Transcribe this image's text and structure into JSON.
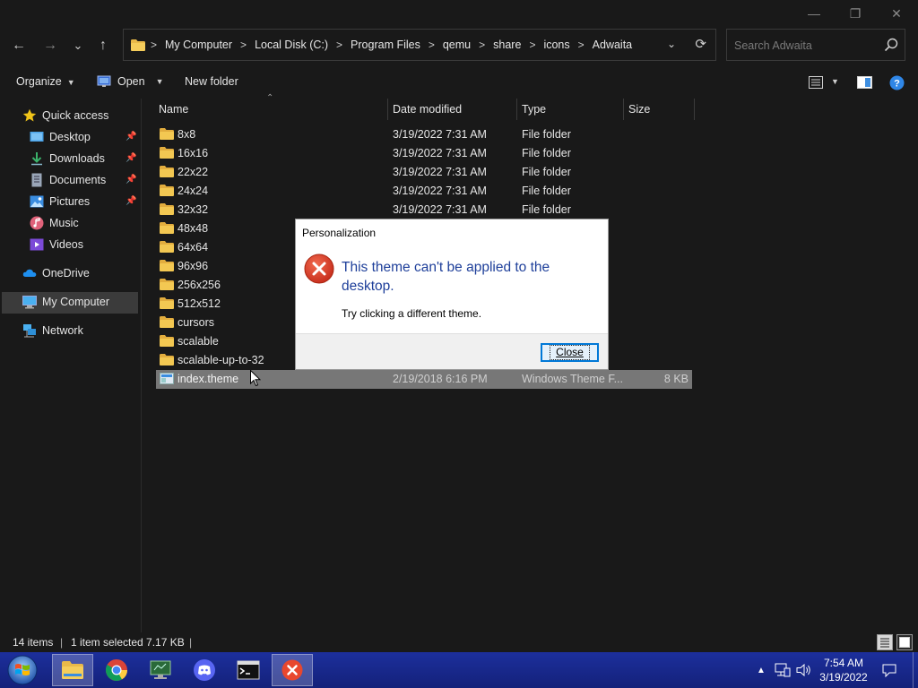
{
  "window": {
    "minimize_glyph": "—",
    "maximize_glyph": "❐",
    "close_glyph": "✕"
  },
  "nav_buttons": {
    "back": "←",
    "forward": "→",
    "recent": "⌄",
    "up": "↑"
  },
  "address": {
    "crumbs": [
      "My Computer",
      "Local Disk (C:)",
      "Program Files",
      "qemu",
      "share",
      "icons",
      "Adwaita"
    ],
    "separator": ">",
    "dropdown_glyph": "⌄",
    "refresh_glyph": "⟳"
  },
  "search": {
    "placeholder": "Search Adwaita"
  },
  "commands": {
    "organize": "Organize",
    "open": "Open",
    "new_folder": "New folder"
  },
  "nav_pane": {
    "items": [
      {
        "label": "Quick access",
        "icon": "star-icon",
        "pinned": false
      },
      {
        "label": "Desktop",
        "icon": "desktop-icon",
        "pinned": true
      },
      {
        "label": "Downloads",
        "icon": "download-icon",
        "pinned": true
      },
      {
        "label": "Documents",
        "icon": "documents-icon",
        "pinned": true
      },
      {
        "label": "Pictures",
        "icon": "pictures-icon",
        "pinned": true
      },
      {
        "label": "Music",
        "icon": "music-icon",
        "pinned": false
      },
      {
        "label": "Videos",
        "icon": "videos-icon",
        "pinned": false
      },
      {
        "label": "OneDrive",
        "icon": "cloud-icon",
        "pinned": false
      },
      {
        "label": "My Computer",
        "icon": "computer-icon",
        "pinned": false
      },
      {
        "label": "Network",
        "icon": "network-icon",
        "pinned": false
      }
    ],
    "selected": "My Computer"
  },
  "columns": {
    "name": "Name",
    "date": "Date modified",
    "type": "Type",
    "size": "Size"
  },
  "files": [
    {
      "name": "8x8",
      "date": "3/19/2022 7:31 AM",
      "type": "File folder",
      "size": ""
    },
    {
      "name": "16x16",
      "date": "3/19/2022 7:31 AM",
      "type": "File folder",
      "size": ""
    },
    {
      "name": "22x22",
      "date": "3/19/2022 7:31 AM",
      "type": "File folder",
      "size": ""
    },
    {
      "name": "24x24",
      "date": "3/19/2022 7:31 AM",
      "type": "File folder",
      "size": ""
    },
    {
      "name": "32x32",
      "date": "3/19/2022 7:31 AM",
      "type": "File folder",
      "size": ""
    },
    {
      "name": "48x48",
      "date": "",
      "type": "",
      "size": ""
    },
    {
      "name": "64x64",
      "date": "",
      "type": "",
      "size": ""
    },
    {
      "name": "96x96",
      "date": "",
      "type": "",
      "size": ""
    },
    {
      "name": "256x256",
      "date": "",
      "type": "",
      "size": ""
    },
    {
      "name": "512x512",
      "date": "",
      "type": "",
      "size": ""
    },
    {
      "name": "cursors",
      "date": "",
      "type": "",
      "size": ""
    },
    {
      "name": "scalable",
      "date": "",
      "type": "",
      "size": ""
    },
    {
      "name": "scalable-up-to-32",
      "date": "",
      "type": "",
      "size": ""
    },
    {
      "name": "index.theme",
      "date": "2/19/2018 6:16 PM",
      "type": "Windows Theme F...",
      "size": "8 KB"
    }
  ],
  "dialog": {
    "title": "Personalization",
    "message": "This theme can't be applied to the desktop.",
    "detail": "Try clicking a different theme.",
    "close_label": "Close",
    "error_glyph": "✕"
  },
  "status": {
    "item_count": "14 items",
    "selection": "1 item selected  7.17 KB"
  },
  "taskbar": {
    "time": "7:54 AM",
    "date": "3/19/2022"
  },
  "colors": {
    "background": "#191919",
    "selected_row": "#777777",
    "dialog_heading": "#1e3f9a",
    "error_red": "#d9322a",
    "taskbar": "#1c2f9c"
  }
}
